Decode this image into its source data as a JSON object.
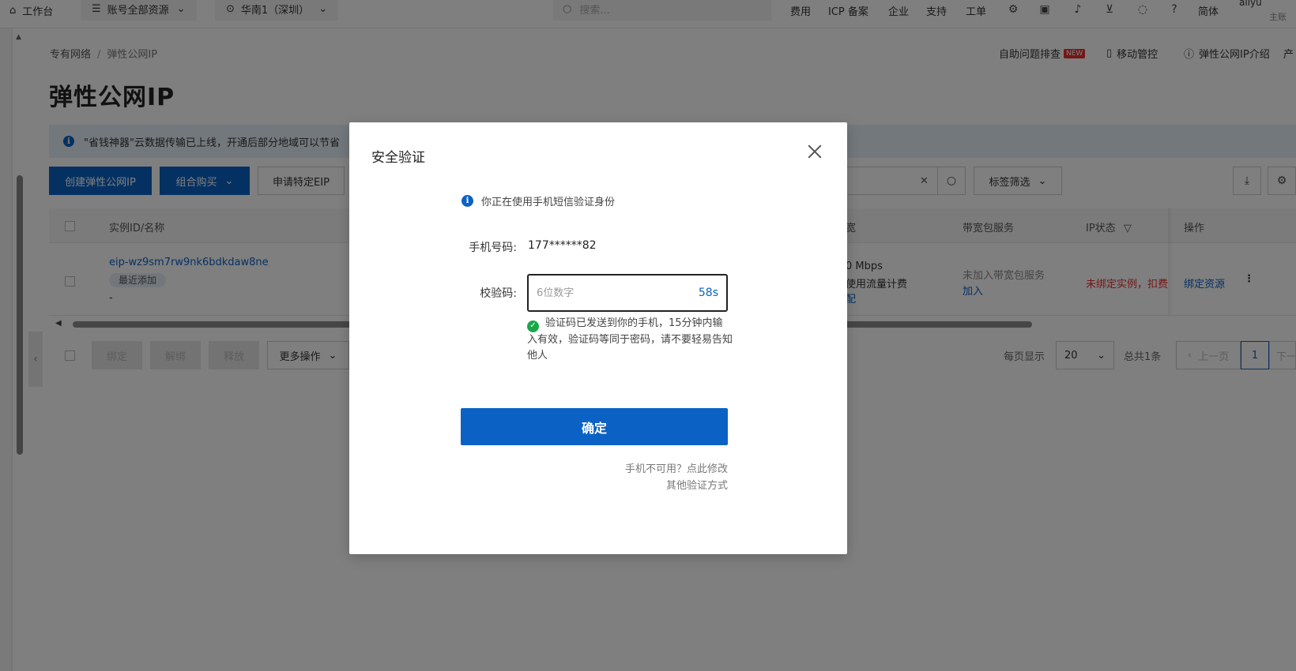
{
  "topbar": {
    "workbench": "工作台",
    "account_resources": "账号全部资源",
    "region": "华南1（深圳）",
    "search_placeholder": "搜索...",
    "links": [
      "费用",
      "ICP 备案",
      "企业",
      "支持",
      "工单"
    ],
    "language": "简体",
    "user": "aliyu",
    "user_sub": "主账"
  },
  "breadcrumb": {
    "parent": "专有网络",
    "current": "弹性公网IP"
  },
  "page_title": "弹性公网IP",
  "top_links": {
    "troubleshoot": "自助问题排查",
    "new_badge": "NEW",
    "mobile": "移动管控",
    "intro": "弹性公网IP介绍",
    "more": "产"
  },
  "notice": {
    "text": "\"省钱神器\"云数据传输已上线，开通后部分地域可以节省"
  },
  "toolbar": {
    "create": "创建弹性公网IP",
    "combo_buy": "组合购买",
    "apply_eip": "申请特定EIP",
    "tag_filter": "标签筛选"
  },
  "table": {
    "headers": {
      "instance": "实例ID/名称",
      "bandwidth": "宽",
      "bandwidth_pkg": "带宽包服务",
      "ip_status": "IP状态",
      "actions": "操作"
    },
    "row": {
      "id": "eip-wz9sm7rw9nk6bdkdaw8ne",
      "tag": "最近添加",
      "name": "-",
      "bw_value": "0 Mbps",
      "bw_billing": "使用流量计费",
      "bw_config": "配",
      "pkg_status": "未加入带宽包服务",
      "pkg_join": "加入",
      "ip_status": "未绑定实例，扣费",
      "bind_action": "绑定资源"
    }
  },
  "bulk": {
    "bind": "绑定",
    "unbind": "解绑",
    "release": "释放",
    "more": "更多操作"
  },
  "pager": {
    "per_page_label": "每页显示",
    "per_page": "20",
    "total": "总共1条",
    "prev": "上一页",
    "page": "1",
    "next": "下一"
  },
  "modal": {
    "title": "安全验证",
    "hint": "你正在使用手机短信验证身份",
    "phone_label": "手机号码:",
    "phone_value": "177******82",
    "code_label": "校验码:",
    "code_placeholder": "6位数字",
    "countdown": "58s",
    "success_msg": "验证码已发送到你的手机，15分钟内输入有效，验证码等同于密码，请不要轻易告知他人",
    "confirm": "确定",
    "phone_unavailable": "手机不可用？点此修改",
    "other_methods": "其他验证方式"
  }
}
